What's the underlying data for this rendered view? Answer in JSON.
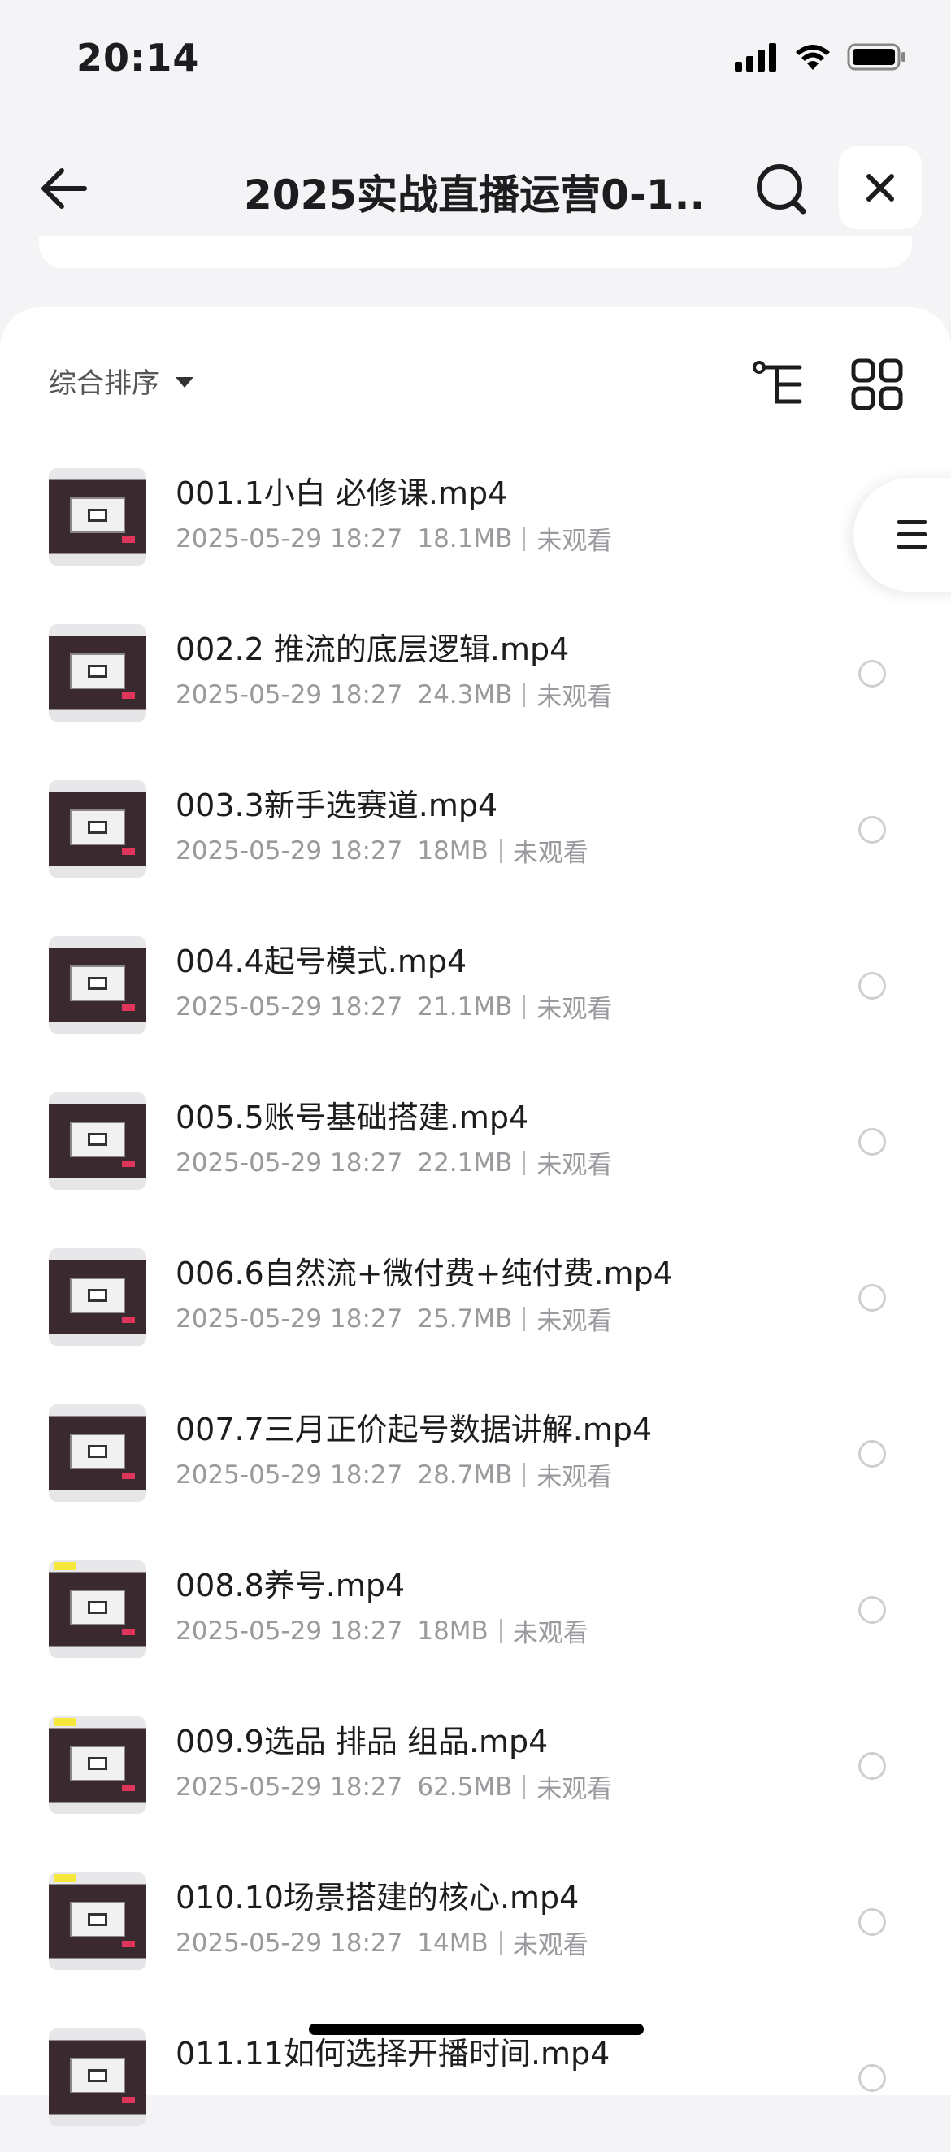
{
  "status_bar": {
    "time": "20:14"
  },
  "nav": {
    "title": "2025实战直播运营0-1..."
  },
  "toolbar": {
    "sort_label": "综合排序"
  },
  "files": [
    {
      "name": "001.1小白 必修课.mp4",
      "date": "2025-05-29 18:27",
      "size": "18.1MB",
      "status": "未观看"
    },
    {
      "name": "002.2 推流的底层逻辑.mp4",
      "date": "2025-05-29 18:27",
      "size": "24.3MB",
      "status": "未观看"
    },
    {
      "name": "003.3新手选赛道.mp4",
      "date": "2025-05-29 18:27",
      "size": "18MB",
      "status": "未观看"
    },
    {
      "name": "004.4起号模式.mp4",
      "date": "2025-05-29 18:27",
      "size": "21.1MB",
      "status": "未观看"
    },
    {
      "name": "005.5账号基础搭建.mp4",
      "date": "2025-05-29 18:27",
      "size": "22.1MB",
      "status": "未观看"
    },
    {
      "name": "006.6自然流+微付费+纯付费.mp4",
      "date": "2025-05-29 18:27",
      "size": "25.7MB",
      "status": "未观看"
    },
    {
      "name": "007.7三月正价起号数据讲解.mp4",
      "date": "2025-05-29 18:27",
      "size": "28.7MB",
      "status": "未观看"
    },
    {
      "name": "008.8养号.mp4",
      "date": "2025-05-29 18:27",
      "size": "18MB",
      "status": "未观看"
    },
    {
      "name": "009.9选品 排品 组品.mp4",
      "date": "2025-05-29 18:27",
      "size": "62.5MB",
      "status": "未观看"
    },
    {
      "name": "010.10场景搭建的核心.mp4",
      "date": "2025-05-29 18:27",
      "size": "14MB",
      "status": "未观看"
    },
    {
      "name": "011.11如何选择开播时间.mp4",
      "date": "",
      "size": "",
      "status": ""
    }
  ]
}
